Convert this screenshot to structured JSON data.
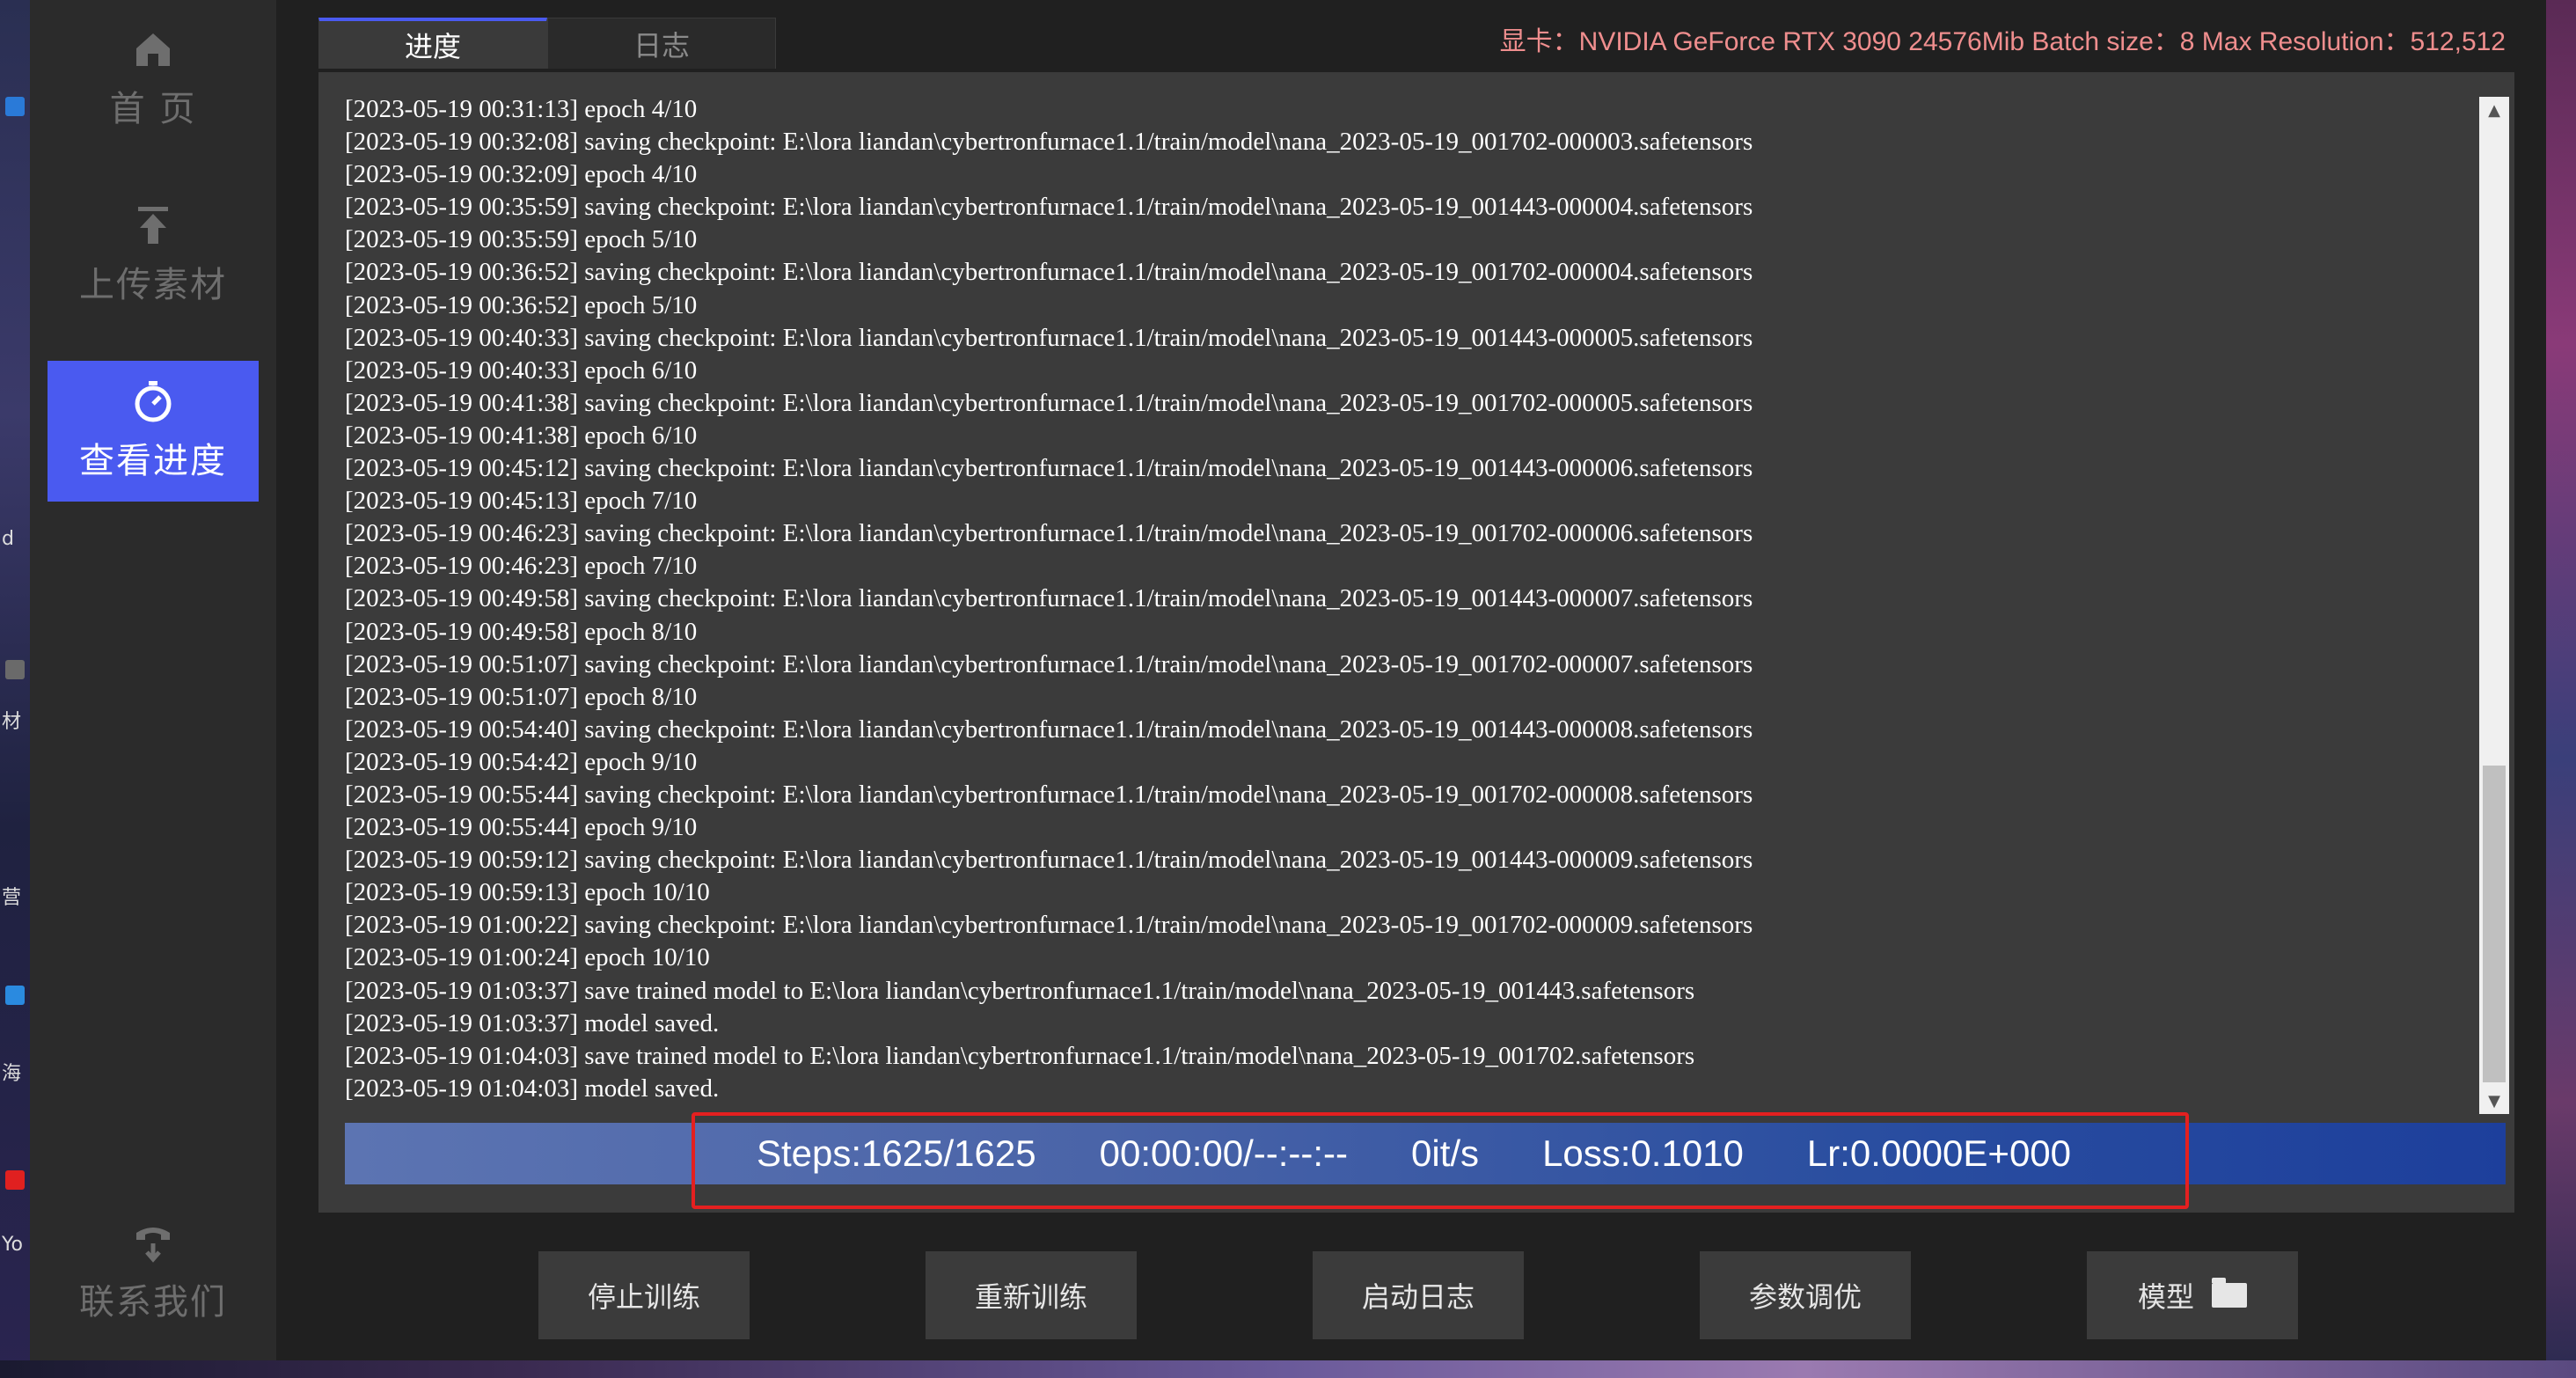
{
  "sidebar": {
    "items": [
      {
        "label": "首 页",
        "icon": "home-icon"
      },
      {
        "label": "上传素材",
        "icon": "upload-icon"
      },
      {
        "label": "查看进度",
        "icon": "stopwatch-icon",
        "active": true
      },
      {
        "label": "联系我们",
        "icon": "phone-icon"
      }
    ]
  },
  "tabs": [
    {
      "label": "进度",
      "active": true
    },
    {
      "label": "日志",
      "active": false
    }
  ],
  "gpu_info": "显卡：NVIDIA GeForce RTX 3090 24576Mib  Batch size：8  Max Resolution：512,512",
  "log_lines": [
    "[2023-05-19 00:31:13] epoch 4/10",
    "[2023-05-19 00:32:08] saving checkpoint: E:\\lora liandan\\cybertronfurnace1.1/train/model\\nana_2023-05-19_001702-000003.safetensors",
    "[2023-05-19 00:32:09] epoch 4/10",
    "[2023-05-19 00:35:59] saving checkpoint: E:\\lora liandan\\cybertronfurnace1.1/train/model\\nana_2023-05-19_001443-000004.safetensors",
    "[2023-05-19 00:35:59] epoch 5/10",
    "[2023-05-19 00:36:52] saving checkpoint: E:\\lora liandan\\cybertronfurnace1.1/train/model\\nana_2023-05-19_001702-000004.safetensors",
    "[2023-05-19 00:36:52] epoch 5/10",
    "[2023-05-19 00:40:33] saving checkpoint: E:\\lora liandan\\cybertronfurnace1.1/train/model\\nana_2023-05-19_001443-000005.safetensors",
    "[2023-05-19 00:40:33] epoch 6/10",
    "[2023-05-19 00:41:38] saving checkpoint: E:\\lora liandan\\cybertronfurnace1.1/train/model\\nana_2023-05-19_001702-000005.safetensors",
    "[2023-05-19 00:41:38] epoch 6/10",
    "[2023-05-19 00:45:12] saving checkpoint: E:\\lora liandan\\cybertronfurnace1.1/train/model\\nana_2023-05-19_001443-000006.safetensors",
    "[2023-05-19 00:45:13] epoch 7/10",
    "[2023-05-19 00:46:23] saving checkpoint: E:\\lora liandan\\cybertronfurnace1.1/train/model\\nana_2023-05-19_001702-000006.safetensors",
    "[2023-05-19 00:46:23] epoch 7/10",
    "[2023-05-19 00:49:58] saving checkpoint: E:\\lora liandan\\cybertronfurnace1.1/train/model\\nana_2023-05-19_001443-000007.safetensors",
    "[2023-05-19 00:49:58] epoch 8/10",
    "[2023-05-19 00:51:07] saving checkpoint: E:\\lora liandan\\cybertronfurnace1.1/train/model\\nana_2023-05-19_001702-000007.safetensors",
    "[2023-05-19 00:51:07] epoch 8/10",
    "[2023-05-19 00:54:40] saving checkpoint: E:\\lora liandan\\cybertronfurnace1.1/train/model\\nana_2023-05-19_001443-000008.safetensors",
    "[2023-05-19 00:54:42] epoch 9/10",
    "[2023-05-19 00:55:44] saving checkpoint: E:\\lora liandan\\cybertronfurnace1.1/train/model\\nana_2023-05-19_001702-000008.safetensors",
    "[2023-05-19 00:55:44] epoch 9/10",
    "[2023-05-19 00:59:12] saving checkpoint: E:\\lora liandan\\cybertronfurnace1.1/train/model\\nana_2023-05-19_001443-000009.safetensors",
    "[2023-05-19 00:59:13] epoch 10/10",
    "[2023-05-19 01:00:22] saving checkpoint: E:\\lora liandan\\cybertronfurnace1.1/train/model\\nana_2023-05-19_001702-000009.safetensors",
    "[2023-05-19 01:00:24] epoch 10/10",
    "[2023-05-19 01:03:37] save trained model to E:\\lora liandan\\cybertronfurnace1.1/train/model\\nana_2023-05-19_001443.safetensors",
    "[2023-05-19 01:03:37] model saved.",
    "[2023-05-19 01:04:03] save trained model to E:\\lora liandan\\cybertronfurnace1.1/train/model\\nana_2023-05-19_001702.safetensors",
    "[2023-05-19 01:04:03] model saved."
  ],
  "status": {
    "steps": "Steps:1625/1625",
    "time": "00:00:00/--:--:--",
    "speed": "0it/s",
    "loss": "Loss:0.1010",
    "lr": "Lr:0.0000E+000"
  },
  "buttons": {
    "stop": "停止训练",
    "restart": "重新训练",
    "start_log": "启动日志",
    "tune": "参数调优",
    "model": "模型"
  },
  "desktop_labels": [
    "d",
    "材",
    "营",
    "海",
    "Yo"
  ],
  "colors": {
    "accent": "#4a5af0",
    "highlight": "#e42020",
    "gpu_text": "#ef8e8e"
  }
}
